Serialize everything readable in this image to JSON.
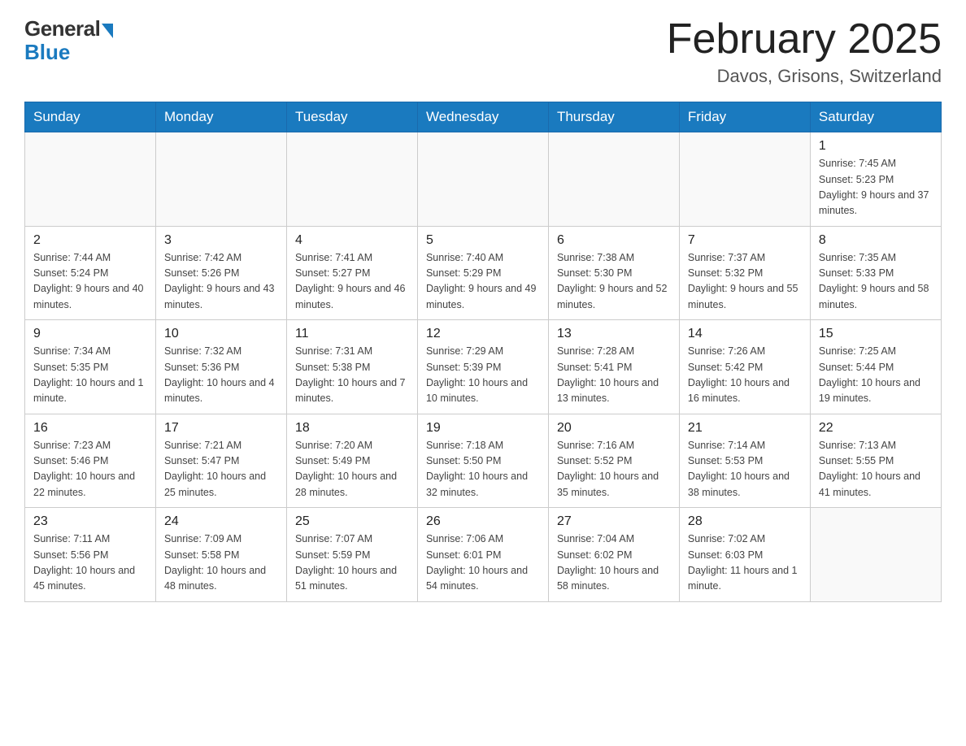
{
  "logo": {
    "general": "General",
    "blue": "Blue"
  },
  "title": "February 2025",
  "location": "Davos, Grisons, Switzerland",
  "weekdays": [
    "Sunday",
    "Monday",
    "Tuesday",
    "Wednesday",
    "Thursday",
    "Friday",
    "Saturday"
  ],
  "weeks": [
    [
      {
        "day": "",
        "info": ""
      },
      {
        "day": "",
        "info": ""
      },
      {
        "day": "",
        "info": ""
      },
      {
        "day": "",
        "info": ""
      },
      {
        "day": "",
        "info": ""
      },
      {
        "day": "",
        "info": ""
      },
      {
        "day": "1",
        "info": "Sunrise: 7:45 AM\nSunset: 5:23 PM\nDaylight: 9 hours and 37 minutes."
      }
    ],
    [
      {
        "day": "2",
        "info": "Sunrise: 7:44 AM\nSunset: 5:24 PM\nDaylight: 9 hours and 40 minutes."
      },
      {
        "day": "3",
        "info": "Sunrise: 7:42 AM\nSunset: 5:26 PM\nDaylight: 9 hours and 43 minutes."
      },
      {
        "day": "4",
        "info": "Sunrise: 7:41 AM\nSunset: 5:27 PM\nDaylight: 9 hours and 46 minutes."
      },
      {
        "day": "5",
        "info": "Sunrise: 7:40 AM\nSunset: 5:29 PM\nDaylight: 9 hours and 49 minutes."
      },
      {
        "day": "6",
        "info": "Sunrise: 7:38 AM\nSunset: 5:30 PM\nDaylight: 9 hours and 52 minutes."
      },
      {
        "day": "7",
        "info": "Sunrise: 7:37 AM\nSunset: 5:32 PM\nDaylight: 9 hours and 55 minutes."
      },
      {
        "day": "8",
        "info": "Sunrise: 7:35 AM\nSunset: 5:33 PM\nDaylight: 9 hours and 58 minutes."
      }
    ],
    [
      {
        "day": "9",
        "info": "Sunrise: 7:34 AM\nSunset: 5:35 PM\nDaylight: 10 hours and 1 minute."
      },
      {
        "day": "10",
        "info": "Sunrise: 7:32 AM\nSunset: 5:36 PM\nDaylight: 10 hours and 4 minutes."
      },
      {
        "day": "11",
        "info": "Sunrise: 7:31 AM\nSunset: 5:38 PM\nDaylight: 10 hours and 7 minutes."
      },
      {
        "day": "12",
        "info": "Sunrise: 7:29 AM\nSunset: 5:39 PM\nDaylight: 10 hours and 10 minutes."
      },
      {
        "day": "13",
        "info": "Sunrise: 7:28 AM\nSunset: 5:41 PM\nDaylight: 10 hours and 13 minutes."
      },
      {
        "day": "14",
        "info": "Sunrise: 7:26 AM\nSunset: 5:42 PM\nDaylight: 10 hours and 16 minutes."
      },
      {
        "day": "15",
        "info": "Sunrise: 7:25 AM\nSunset: 5:44 PM\nDaylight: 10 hours and 19 minutes."
      }
    ],
    [
      {
        "day": "16",
        "info": "Sunrise: 7:23 AM\nSunset: 5:46 PM\nDaylight: 10 hours and 22 minutes."
      },
      {
        "day": "17",
        "info": "Sunrise: 7:21 AM\nSunset: 5:47 PM\nDaylight: 10 hours and 25 minutes."
      },
      {
        "day": "18",
        "info": "Sunrise: 7:20 AM\nSunset: 5:49 PM\nDaylight: 10 hours and 28 minutes."
      },
      {
        "day": "19",
        "info": "Sunrise: 7:18 AM\nSunset: 5:50 PM\nDaylight: 10 hours and 32 minutes."
      },
      {
        "day": "20",
        "info": "Sunrise: 7:16 AM\nSunset: 5:52 PM\nDaylight: 10 hours and 35 minutes."
      },
      {
        "day": "21",
        "info": "Sunrise: 7:14 AM\nSunset: 5:53 PM\nDaylight: 10 hours and 38 minutes."
      },
      {
        "day": "22",
        "info": "Sunrise: 7:13 AM\nSunset: 5:55 PM\nDaylight: 10 hours and 41 minutes."
      }
    ],
    [
      {
        "day": "23",
        "info": "Sunrise: 7:11 AM\nSunset: 5:56 PM\nDaylight: 10 hours and 45 minutes."
      },
      {
        "day": "24",
        "info": "Sunrise: 7:09 AM\nSunset: 5:58 PM\nDaylight: 10 hours and 48 minutes."
      },
      {
        "day": "25",
        "info": "Sunrise: 7:07 AM\nSunset: 5:59 PM\nDaylight: 10 hours and 51 minutes."
      },
      {
        "day": "26",
        "info": "Sunrise: 7:06 AM\nSunset: 6:01 PM\nDaylight: 10 hours and 54 minutes."
      },
      {
        "day": "27",
        "info": "Sunrise: 7:04 AM\nSunset: 6:02 PM\nDaylight: 10 hours and 58 minutes."
      },
      {
        "day": "28",
        "info": "Sunrise: 7:02 AM\nSunset: 6:03 PM\nDaylight: 11 hours and 1 minute."
      },
      {
        "day": "",
        "info": ""
      }
    ]
  ]
}
